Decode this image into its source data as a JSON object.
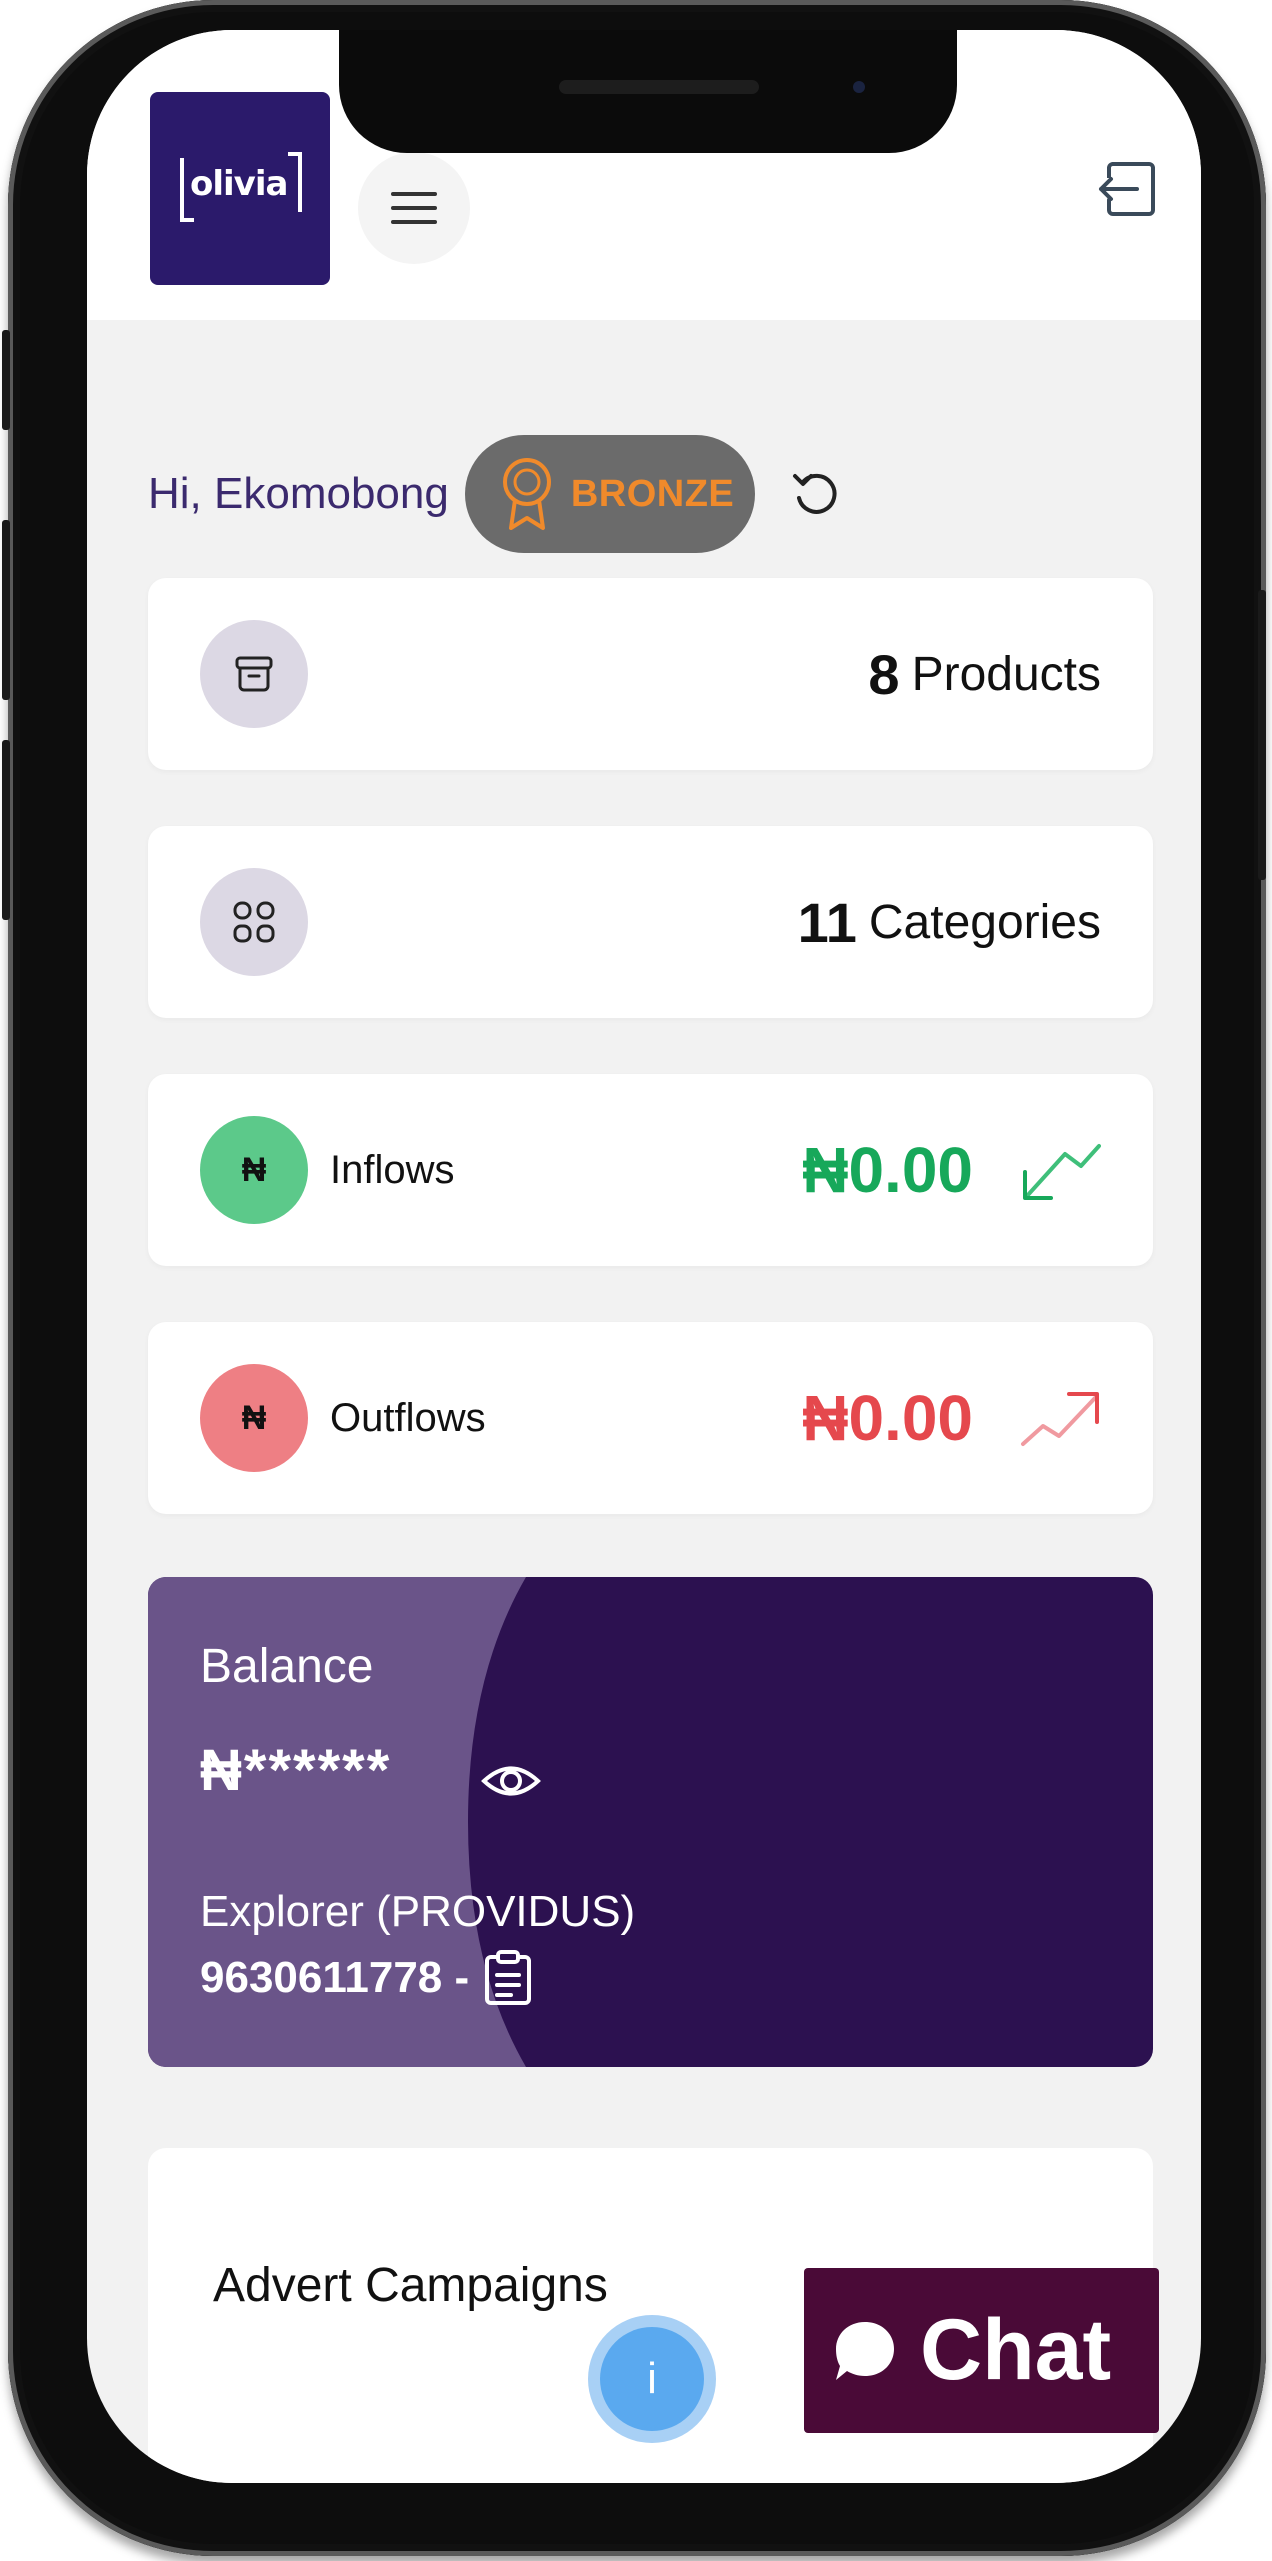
{
  "header": {
    "logo_text": "olivia",
    "menu_icon": "hamburger-icon",
    "logout_icon": "logout-icon"
  },
  "greeting": {
    "text": "Hi, Ekomobong",
    "tier": "BRONZE",
    "refresh_icon": "refresh-icon"
  },
  "stats": {
    "products": {
      "count": "8",
      "label": "Products"
    },
    "categories": {
      "count": "11",
      "label": "Categories"
    }
  },
  "flows": {
    "inflows": {
      "label": "Inflows",
      "amount": "₦0.00",
      "color": "#17a85a"
    },
    "outflows": {
      "label": "Outflows",
      "amount": "₦0.00",
      "color": "#e5484d"
    },
    "currency_symbol": "₦"
  },
  "balance": {
    "label": "Balance",
    "masked_value": "₦******",
    "bank": "Explorer (PROVIDUS)",
    "account": "9630611778 -"
  },
  "advert": {
    "title": "Advert Campaigns"
  },
  "info_button": {
    "label": "i"
  },
  "chat_button": {
    "label": "Chat"
  },
  "colors": {
    "brand": "#2b1a6b",
    "balance_dark": "#2c1150",
    "balance_light": "#6a5489",
    "chat": "#4a0a37",
    "bronze": "#f08a2b"
  }
}
